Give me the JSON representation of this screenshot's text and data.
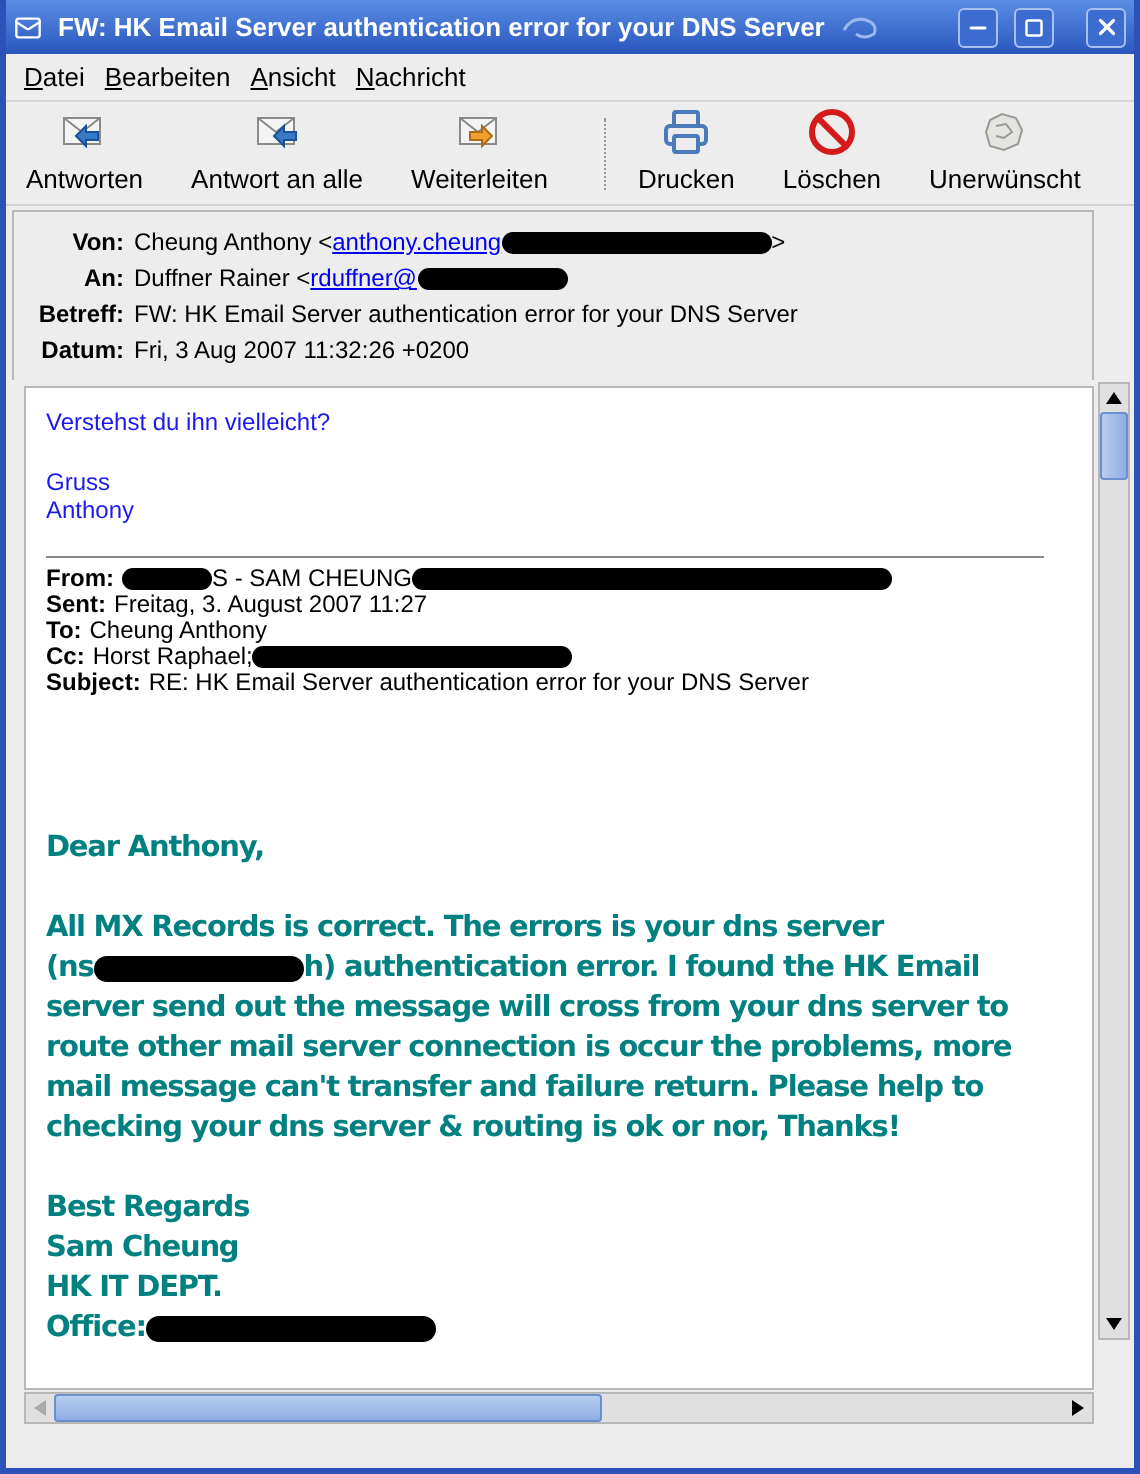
{
  "window": {
    "title": "FW: HK Email Server authentication error for your DNS Server"
  },
  "menu": [
    "Datei",
    "Bearbeiten",
    "Ansicht",
    "Nachricht"
  ],
  "toolbar": [
    {
      "label": "Antworten",
      "kind": "reply"
    },
    {
      "label": "Antwort an alle",
      "kind": "reply_all"
    },
    {
      "label": "Weiterleiten",
      "kind": "forward"
    },
    {
      "kind": "separator"
    },
    {
      "label": "Drucken",
      "kind": "print"
    },
    {
      "label": "Löschen",
      "kind": "delete"
    },
    {
      "label": "Unerwünscht",
      "kind": "junk"
    }
  ],
  "headers": [
    {
      "label": "Von:",
      "segments": [
        {
          "kind": "text",
          "text": "Cheung Anthony <"
        },
        {
          "kind": "link",
          "text": "anthony.cheung"
        },
        {
          "kind": "redaction"
        },
        {
          "kind": "text",
          "text": ">"
        }
      ]
    },
    {
      "label": "An:",
      "segments": [
        {
          "kind": "text",
          "text": "Duffner Rainer <"
        },
        {
          "kind": "link",
          "text": "rduffner@"
        },
        {
          "kind": "redaction"
        }
      ]
    },
    {
      "label": "Betreff:",
      "segments": [
        {
          "kind": "text",
          "text": "FW: HK Email Server authentication error for your DNS Server"
        }
      ]
    },
    {
      "label": "Datum:",
      "segments": [
        {
          "kind": "text",
          "text": "Fri, 3 Aug 2007 11:32:26 +0200"
        }
      ]
    }
  ],
  "message": [
    {
      "kind": "reply",
      "lines": [
        {
          "segments": [
            {
              "kind": "text",
              "text": "Verstehst du ihn vielleicht?"
            }
          ]
        }
      ]
    },
    {
      "kind": "reply",
      "lines": [
        {
          "segments": [
            {
              "kind": "text",
              "text": "Gruss"
            }
          ]
        },
        {
          "segments": [
            {
              "kind": "text",
              "text": "Anthony"
            }
          ]
        }
      ]
    },
    {
      "kind": "rule"
    },
    {
      "kind": "forward_header",
      "lines": [
        {
          "label": "From:",
          "segments": [
            {
              "kind": "redaction"
            },
            {
              "kind": "text",
              "text": "S - SAM CHEUNG"
            },
            {
              "kind": "redaction"
            }
          ]
        },
        {
          "label": "Sent:",
          "segments": [
            {
              "kind": "text",
              "text": "Freitag, 3. August 2007 11:27"
            }
          ]
        },
        {
          "label": "To:",
          "segments": [
            {
              "kind": "text",
              "text": "Cheung Anthony"
            }
          ]
        },
        {
          "label": "Cc:",
          "segments": [
            {
              "kind": "text",
              "text": "Horst Raphael;"
            },
            {
              "kind": "redaction"
            }
          ]
        },
        {
          "label": "Subject:",
          "segments": [
            {
              "kind": "text",
              "text": "RE: HK Email Server authentication error for your DNS Server"
            }
          ]
        }
      ]
    },
    {
      "kind": "body",
      "lines": [
        {
          "segments": [
            {
              "kind": "text",
              "text": "Dear Anthony,"
            }
          ]
        }
      ]
    },
    {
      "kind": "body",
      "lines": [
        {
          "segments": [
            {
              "kind": "text",
              "text": "All MX Records is correct. The errors is your dns server"
            }
          ]
        },
        {
          "segments": [
            {
              "kind": "text",
              "text": "(ns"
            },
            {
              "kind": "redaction"
            },
            {
              "kind": "text",
              "text": "h) authentication error. I found the HK Email"
            }
          ]
        },
        {
          "segments": [
            {
              "kind": "text",
              "text": "server send out the message will cross from your dns server to"
            }
          ]
        },
        {
          "segments": [
            {
              "kind": "text",
              "text": "route other mail server connection is occur the problems, more"
            }
          ]
        },
        {
          "segments": [
            {
              "kind": "text",
              "text": "mail message can't transfer and failure return. Please help to"
            }
          ]
        },
        {
          "segments": [
            {
              "kind": "text",
              "text": "checking your dns server & routing is ok or nor, Thanks!"
            }
          ]
        }
      ]
    },
    {
      "kind": "body",
      "lines": [
        {
          "segments": [
            {
              "kind": "text",
              "text": "Best Regards"
            }
          ]
        },
        {
          "segments": [
            {
              "kind": "text",
              "text": "Sam Cheung"
            }
          ]
        },
        {
          "segments": [
            {
              "kind": "text",
              "text": "HK IT DEPT."
            }
          ]
        },
        {
          "segments": [
            {
              "kind": "text",
              "text": "Office:"
            },
            {
              "kind": "redaction"
            }
          ]
        }
      ]
    }
  ]
}
